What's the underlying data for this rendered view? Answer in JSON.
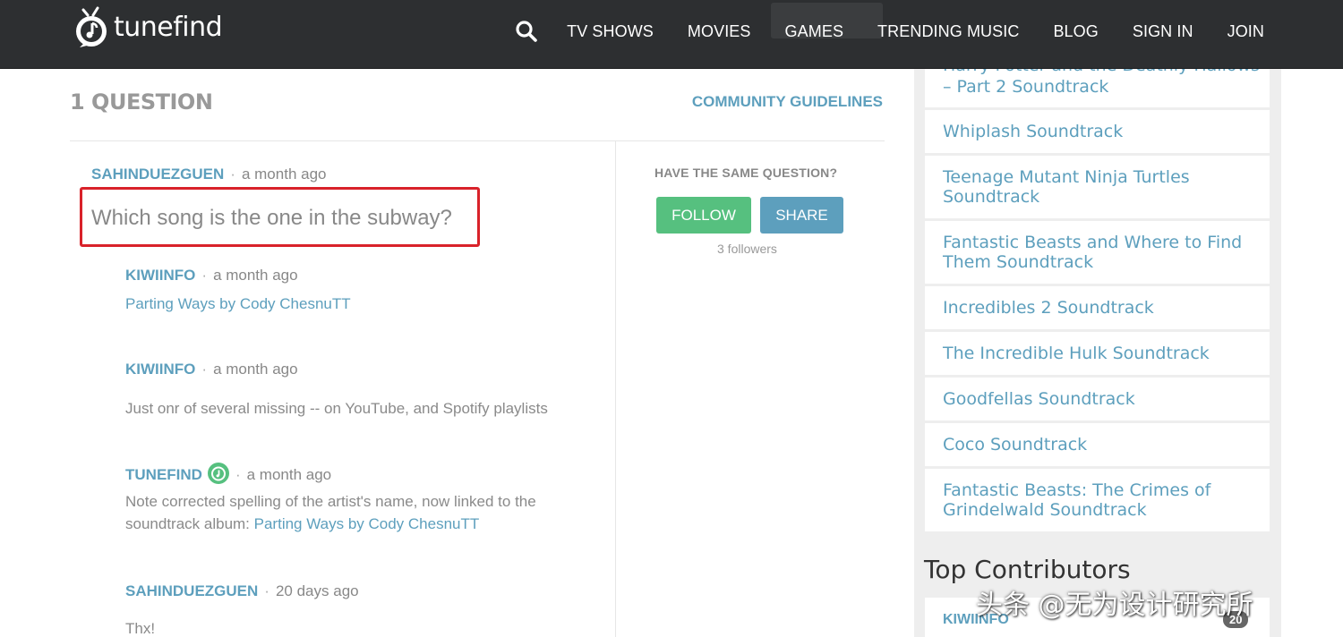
{
  "header": {
    "logo_text": "tunefind",
    "nav": [
      "TV SHOWS",
      "MOVIES",
      "GAMES",
      "TRENDING MUSIC",
      "BLOG",
      "SIGN IN",
      "JOIN"
    ]
  },
  "main": {
    "question_count": "1 QUESTION",
    "guidelines_label": "COMMUNITY GUIDELINES",
    "question": {
      "user": "SAHINDUEZGUEN",
      "time": "a month ago",
      "text": "Which song is the one in the subway?"
    },
    "answers": [
      {
        "user": "KIWIINFO",
        "time": "a month ago",
        "link_text": "Parting Ways by Cody ChesnuTT"
      },
      {
        "user": "KIWIINFO",
        "time": "a month ago",
        "text": "Just onr of several missing -- on YouTube, and Spotify playlists"
      },
      {
        "user": "TUNEFIND",
        "time": "a month ago",
        "text": "Note corrected spelling of the artist's name, now linked to the soundtrack album:",
        "link_text": "Parting Ways by Cody ChesnuTT"
      },
      {
        "user": "SAHINDUEZGUEN",
        "time": "20 days ago",
        "text": "Thx!"
      }
    ],
    "side": {
      "prompt": "HAVE THE SAME QUESTION?",
      "follow_label": "FOLLOW",
      "share_label": "SHARE",
      "followers": "3 followers"
    }
  },
  "sidebar": {
    "items": [
      "– Part 2 Soundtrack",
      "Whiplash Soundtrack",
      "Teenage Mutant Ninja Turtles Soundtrack",
      "Fantastic Beasts and Where to Find Them Soundtrack",
      "Incredibles 2 Soundtrack",
      "The Incredible Hulk Soundtrack",
      "Goodfellas Soundtrack",
      "Coco Soundtrack",
      "Fantastic Beasts: The Crimes of Grindelwald Soundtrack"
    ],
    "partial_item": "Harry Potter and the Deathly Hallows",
    "top_contributors_title": "Top Contributors",
    "contributors": [
      {
        "name": "KIWIINFO",
        "count": "20"
      }
    ]
  },
  "watermark": "头条 @无为设计研究所",
  "colors": {
    "accent": "#5d9fbd",
    "follow": "#56c07f",
    "header": "#2d2f31",
    "highlight": "#d9222a"
  }
}
